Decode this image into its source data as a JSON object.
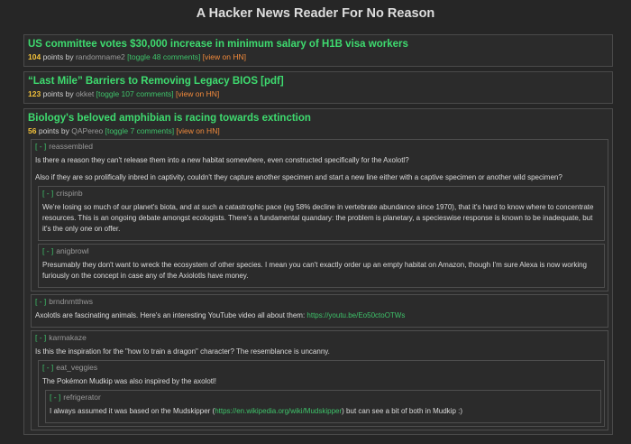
{
  "page": {
    "title": "A Hacker News Reader For No Reason"
  },
  "labels": {
    "points_by": "points by",
    "collapse": "[ - ]"
  },
  "stories": [
    {
      "title": "US committee votes $30,000 increase in minimum salary of H1B visa workers",
      "points": "104",
      "user": "randomname2",
      "toggle": "[toggle 48 comments]",
      "hn": "[view on HN]"
    },
    {
      "title": "“Last Mile” Barriers to Removing Legacy BIOS [pdf]",
      "points": "123",
      "user": "okket",
      "toggle": "[toggle 107 comments]",
      "hn": "[view on HN]"
    },
    {
      "title": "Biology's beloved amphibian is racing towards extinction",
      "points": "56",
      "user": "QAPereo",
      "toggle": "[toggle 7 comments]",
      "hn": "[view on HN]",
      "comments": [
        {
          "user": "reassembled",
          "p1": "Is there a reason they can't release them into a new habitat somewhere, even constructed specifically for the Axolotl?",
          "p2": "Also if they are so prolifically inbred in captivity, couldn't they capture another specimen and start a new line either with a captive specimen or another wild specimen?",
          "replies": [
            {
              "user": "crispinb",
              "p1": "We're losing so much of our planet's biota, and at such a catastrophic pace (eg 58% decline in vertebrate abundance since 1970), that it's hard to know where to concentrate resources. This is an ongoing debate amongst ecologists. There's a fundamental quandary: the problem is planetary, a specieswise response is known to be inadequate, but it's the only one on offer."
            },
            {
              "user": "anigbrowl",
              "p1": "Presumably they don't want to wreck the ecosystem of other species. I mean you can't exactly order up an empty habitat on Amazon, though I'm sure Alexa is now working furiously on the concept in case any of the Axiolotls have money."
            }
          ]
        },
        {
          "user": "brndnmtthws",
          "p1": "Axolotls are fascinating animals. Here's an interesting YouTube video all about them: ",
          "link": "https://youtu.be/Eo50ctoOTWs"
        },
        {
          "user": "karmakaze",
          "p1": "Is this the inspiration for the \"how to train a dragon\" character? The resemblance is uncanny.",
          "replies": [
            {
              "user": "eat_veggies",
              "p1": "The Pokémon Mudkip was also inspired by the axolotl!",
              "replies": [
                {
                  "user": "refrigerator",
                  "p1": "I always assumed it was based on the Mudskipper (",
                  "link": "https://en.wikipedia.org/wiki/Mudskipper",
                  "p2": ") but can see a bit of both in Mudkip :)"
                }
              ]
            }
          ]
        }
      ]
    }
  ]
}
